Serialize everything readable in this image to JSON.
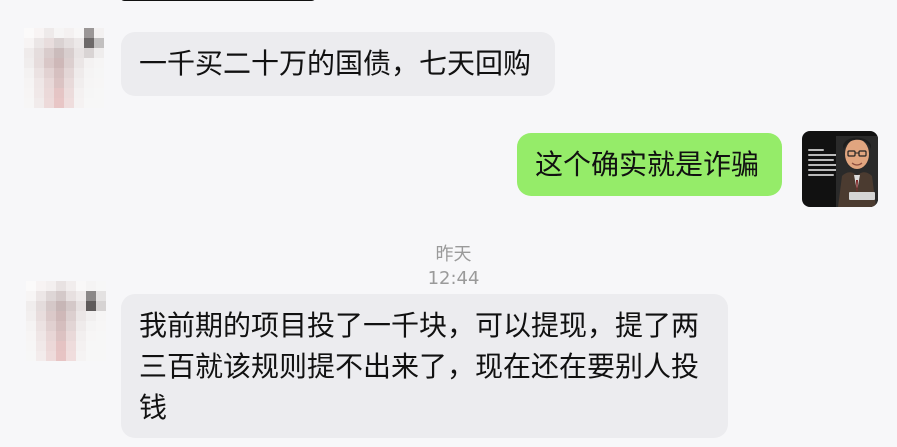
{
  "chat": {
    "messages": [
      {
        "side": "left",
        "text": "一千买二十万的国债，七天回购"
      },
      {
        "side": "right",
        "text": "这个确实就是诈骗"
      },
      {
        "side": "left",
        "text": "我前期的项目投了一千块，可以提现，提了两三百就该规则提不出来了，现在还在要别人投钱"
      }
    ],
    "timestamp": "昨天 12:44"
  },
  "colors": {
    "background": "#f7f7f9",
    "incoming_bubble": "#ececef",
    "outgoing_bubble": "#95ec69",
    "timestamp_text": "#9a9a9a"
  },
  "icons": {
    "left_avatar": "blurred-profile-avatar",
    "right_avatar": "news-profile-avatar"
  }
}
